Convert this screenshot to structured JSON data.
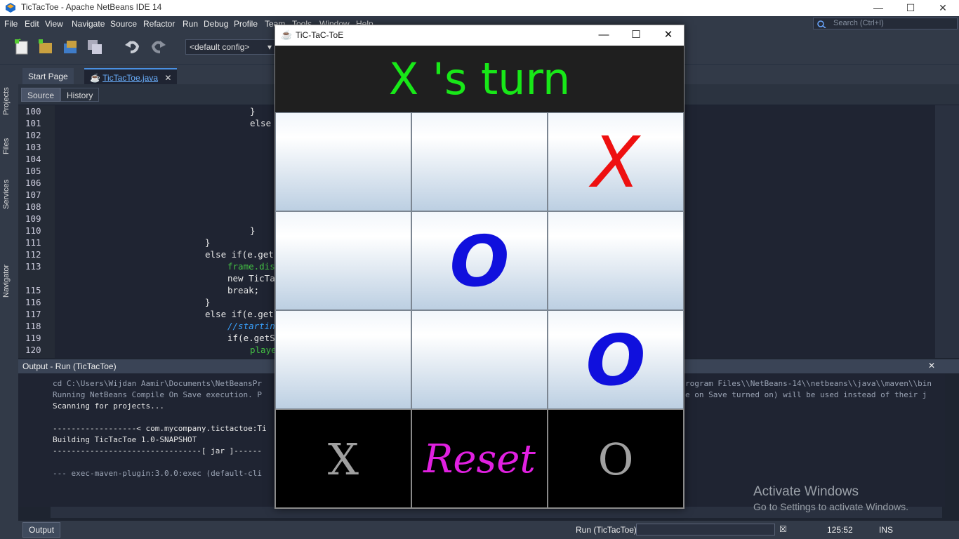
{
  "window": {
    "title": "TicTacToe - Apache NetBeans IDE 14"
  },
  "menu": [
    "File",
    "Edit",
    "View",
    "Navigate",
    "Source",
    "Refactor",
    "Run",
    "Debug",
    "Profile",
    "Team",
    "Tools",
    "Window",
    "Help"
  ],
  "search": {
    "placeholder": "Search (Ctrl+I)"
  },
  "toolbar": {
    "config": "<default config>"
  },
  "sidebar": {
    "projects": "Projects",
    "files": "Files",
    "services": "Services",
    "navigator": "Navigator"
  },
  "editor": {
    "tabs": [
      {
        "label": "Start Page"
      },
      {
        "label": "TicTacToe.java"
      }
    ],
    "source_label": "Source",
    "history_label": "History",
    "lines": [
      {
        "n": "100",
        "code": "}",
        "indent": 320,
        "cls": "kw"
      },
      {
        "n": "101",
        "code": "else",
        "indent": 320,
        "cls": "kw"
      },
      {
        "n": "102",
        "code": "",
        "indent": 0,
        "cls": "kw"
      },
      {
        "n": "103",
        "code": "",
        "indent": 0,
        "cls": "kw"
      },
      {
        "n": "104",
        "code": "",
        "indent": 0,
        "cls": "kw"
      },
      {
        "n": "105",
        "code": "",
        "indent": 0,
        "cls": "kw"
      },
      {
        "n": "106",
        "code": "",
        "indent": 0,
        "cls": "kw"
      },
      {
        "n": "107",
        "code": "",
        "indent": 0,
        "cls": "kw"
      },
      {
        "n": "108",
        "code": "",
        "indent": 0,
        "cls": "kw"
      },
      {
        "n": "109",
        "code": "",
        "indent": 0,
        "cls": "kw"
      },
      {
        "n": "110",
        "code": "}",
        "indent": 320,
        "cls": "kw"
      },
      {
        "n": "111",
        "code": "}",
        "indent": 256,
        "cls": "kw"
      },
      {
        "n": "112",
        "code": "else if(e.get",
        "indent": 256,
        "cls": "kw"
      },
      {
        "n": "113",
        "code": "frame.dis",
        "indent": 288,
        "cls": "gr"
      },
      {
        "n": "",
        "code": "new TicTa",
        "indent": 288,
        "cls": "kw"
      },
      {
        "n": "115",
        "code": "break;",
        "indent": 288,
        "cls": "kw"
      },
      {
        "n": "116",
        "code": "}",
        "indent": 256,
        "cls": "kw"
      },
      {
        "n": "117",
        "code": "else if(e.get",
        "indent": 256,
        "cls": "kw"
      },
      {
        "n": "118",
        "code": "//startin",
        "indent": 288,
        "cls": "cm"
      },
      {
        "n": "119",
        "code": "if(e.getS",
        "indent": 288,
        "cls": "kw"
      },
      {
        "n": "120",
        "code": "playe",
        "indent": 320,
        "cls": "gr"
      }
    ]
  },
  "output": {
    "title": "Output - Run (TicTacToe)",
    "lines": [
      {
        "text": "cd C:\\Users\\Wijdan Aamir\\Documents\\NetBeansPr",
        "white": false
      },
      {
        "text": "Running NetBeans Compile On Save execution. P",
        "white": false
      },
      {
        "text": "Scanning for projects...",
        "white": true
      },
      {
        "text": "",
        "white": false
      },
      {
        "text": "------------------< com.mycompany.tictactoe:Ti",
        "white": true
      },
      {
        "text": "Building TicTacToe 1.0-SNAPSHOT",
        "white": true
      },
      {
        "text": "--------------------------------[ jar ]------",
        "white": true
      },
      {
        "text": "",
        "white": false
      },
      {
        "text": "--- exec-maven-plugin:3.0.0:exec (default-cli",
        "white": false
      }
    ],
    "right_lines": [
      "rogram Files\\\\NetBeans-14\\\\netbeans\\\\java\\\\maven\\\\bin",
      "e on Save turned on) will be used instead of their j"
    ]
  },
  "status": {
    "output_tab": "Output",
    "run_label": "Run (TicTacToe)",
    "position": "125:52",
    "mode": "INS"
  },
  "watermark": {
    "line1": "Activate Windows",
    "line2": "Go to Settings to activate Windows."
  },
  "game": {
    "title": "TiC-TaC-ToE",
    "turn_text": "X 's turn",
    "board": [
      "",
      "",
      "X",
      "",
      "O",
      "",
      "",
      "",
      "O"
    ],
    "colors": {
      "x": "#ee1010",
      "o": "#1010dd",
      "turn": "#18e818",
      "reset": "#e020e0",
      "score": "#a0a0a0"
    },
    "x_label": "X",
    "reset_label": "Reset",
    "o_label": "O"
  }
}
